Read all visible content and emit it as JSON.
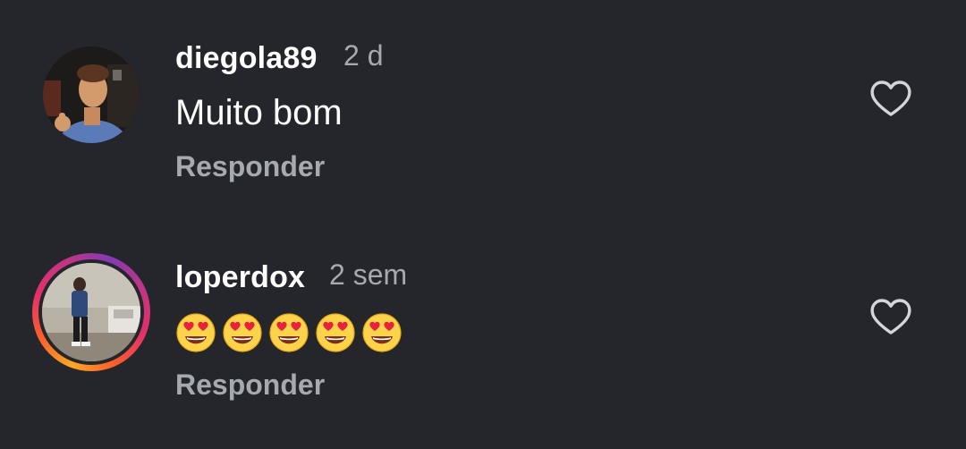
{
  "comments": [
    {
      "username": "diegola89",
      "time": "2 d",
      "text": "Muito bom",
      "reply_label": "Responder",
      "avatar_icon": "profile-photo",
      "like_icon": "heart-outline-icon",
      "has_story_ring": false
    },
    {
      "username": "loperdox",
      "time": "2 sem",
      "emojis": [
        "😍",
        "😍",
        "😍",
        "😍",
        "😍"
      ],
      "reply_label": "Responder",
      "avatar_icon": "profile-photo",
      "like_icon": "heart-outline-icon",
      "has_story_ring": true
    }
  ],
  "colors": {
    "background": "#25262b",
    "primary_text": "#ffffff",
    "secondary_text": "#a7a9b0",
    "story_ring_gradient": [
      "#f9a825",
      "#fb5c2b",
      "#e1306c",
      "#c13584",
      "#833ab4"
    ]
  }
}
